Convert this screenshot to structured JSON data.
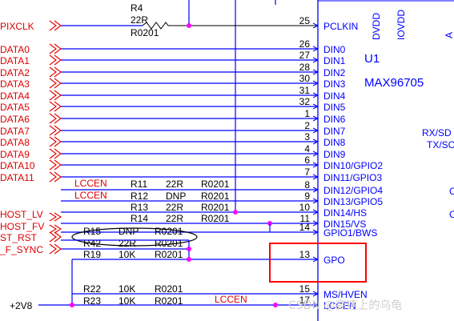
{
  "chip": {
    "designator": "U1",
    "part": "MAX96705",
    "top_pins": [
      "DVDD",
      "IOVDD"
    ],
    "right_pins": [
      "RX/SD",
      "TX/SC",
      "C",
      "C"
    ],
    "left_pins": [
      {
        "num": "25",
        "name": "PCLKIN"
      },
      {
        "num": "26",
        "name": "DIN0"
      },
      {
        "num": "27",
        "name": "DIN1"
      },
      {
        "num": "28",
        "name": "DIN2"
      },
      {
        "num": "30",
        "name": "DIN3"
      },
      {
        "num": "31",
        "name": "DIN4"
      },
      {
        "num": "32",
        "name": "DIN5"
      },
      {
        "num": "1",
        "name": "DIN6"
      },
      {
        "num": "2",
        "name": "DIN7"
      },
      {
        "num": "3",
        "name": "DIN8"
      },
      {
        "num": "4",
        "name": "DIN9"
      },
      {
        "num": "6",
        "name": "DIN10/GPIO2"
      },
      {
        "num": "7",
        "name": "DIN11/GPIO3"
      },
      {
        "num": "8",
        "name": "DIN12/GPIO4"
      },
      {
        "num": "9",
        "name": "DIN13/GPIO5"
      },
      {
        "num": "10",
        "name": "DIN14/HS"
      },
      {
        "num": "11",
        "name": "DIN15/VS"
      },
      {
        "num": "14",
        "name": "GPIO1/BWS"
      },
      {
        "num": "13",
        "name": "GPO"
      },
      {
        "num": "15",
        "name": "MS/HVEN"
      },
      {
        "num": "17",
        "name": "LCCEN"
      }
    ]
  },
  "nets": {
    "pixclk": "PIXCLK",
    "data": [
      "DATA0",
      "DATA1",
      "DATA2",
      "DATA3",
      "DATA4",
      "DATA5",
      "DATA6",
      "DATA7",
      "DATA8",
      "DATA9",
      "DATA10",
      "DATA11"
    ],
    "host_lv": "HOST_LV",
    "host_fv": "HOST_FV",
    "st_rst": "ST_RST",
    "f_sync": "_F_SYNC",
    "lccen": "LCCEN",
    "supply": "+2V8"
  },
  "resistors": [
    {
      "ref": "R4",
      "value": "22R",
      "package": "R0201"
    },
    {
      "ref": "R11",
      "value": "22R",
      "package": "R0201"
    },
    {
      "ref": "R12",
      "value": "DNP",
      "package": "R0201"
    },
    {
      "ref": "R13",
      "value": "22R",
      "package": "R0201"
    },
    {
      "ref": "R14",
      "value": "22R",
      "package": "R0201"
    },
    {
      "ref": "R15",
      "value": "DNP",
      "package": "R0201"
    },
    {
      "ref": "R42",
      "value": "22R",
      "package": "R0201"
    },
    {
      "ref": "R19",
      "value": "10K",
      "package": "R0201"
    },
    {
      "ref": "R22",
      "value": "10K",
      "package": "R0201"
    },
    {
      "ref": "R23",
      "value": "10K",
      "package": "R0201"
    }
  ],
  "watermark": "CSDN @高速上的乌龟",
  "colors": {
    "wire": "#0000ff",
    "net_label": "#e00000",
    "junction": "#ff00ff",
    "highlight": "#ff0000",
    "component": "#000000"
  }
}
